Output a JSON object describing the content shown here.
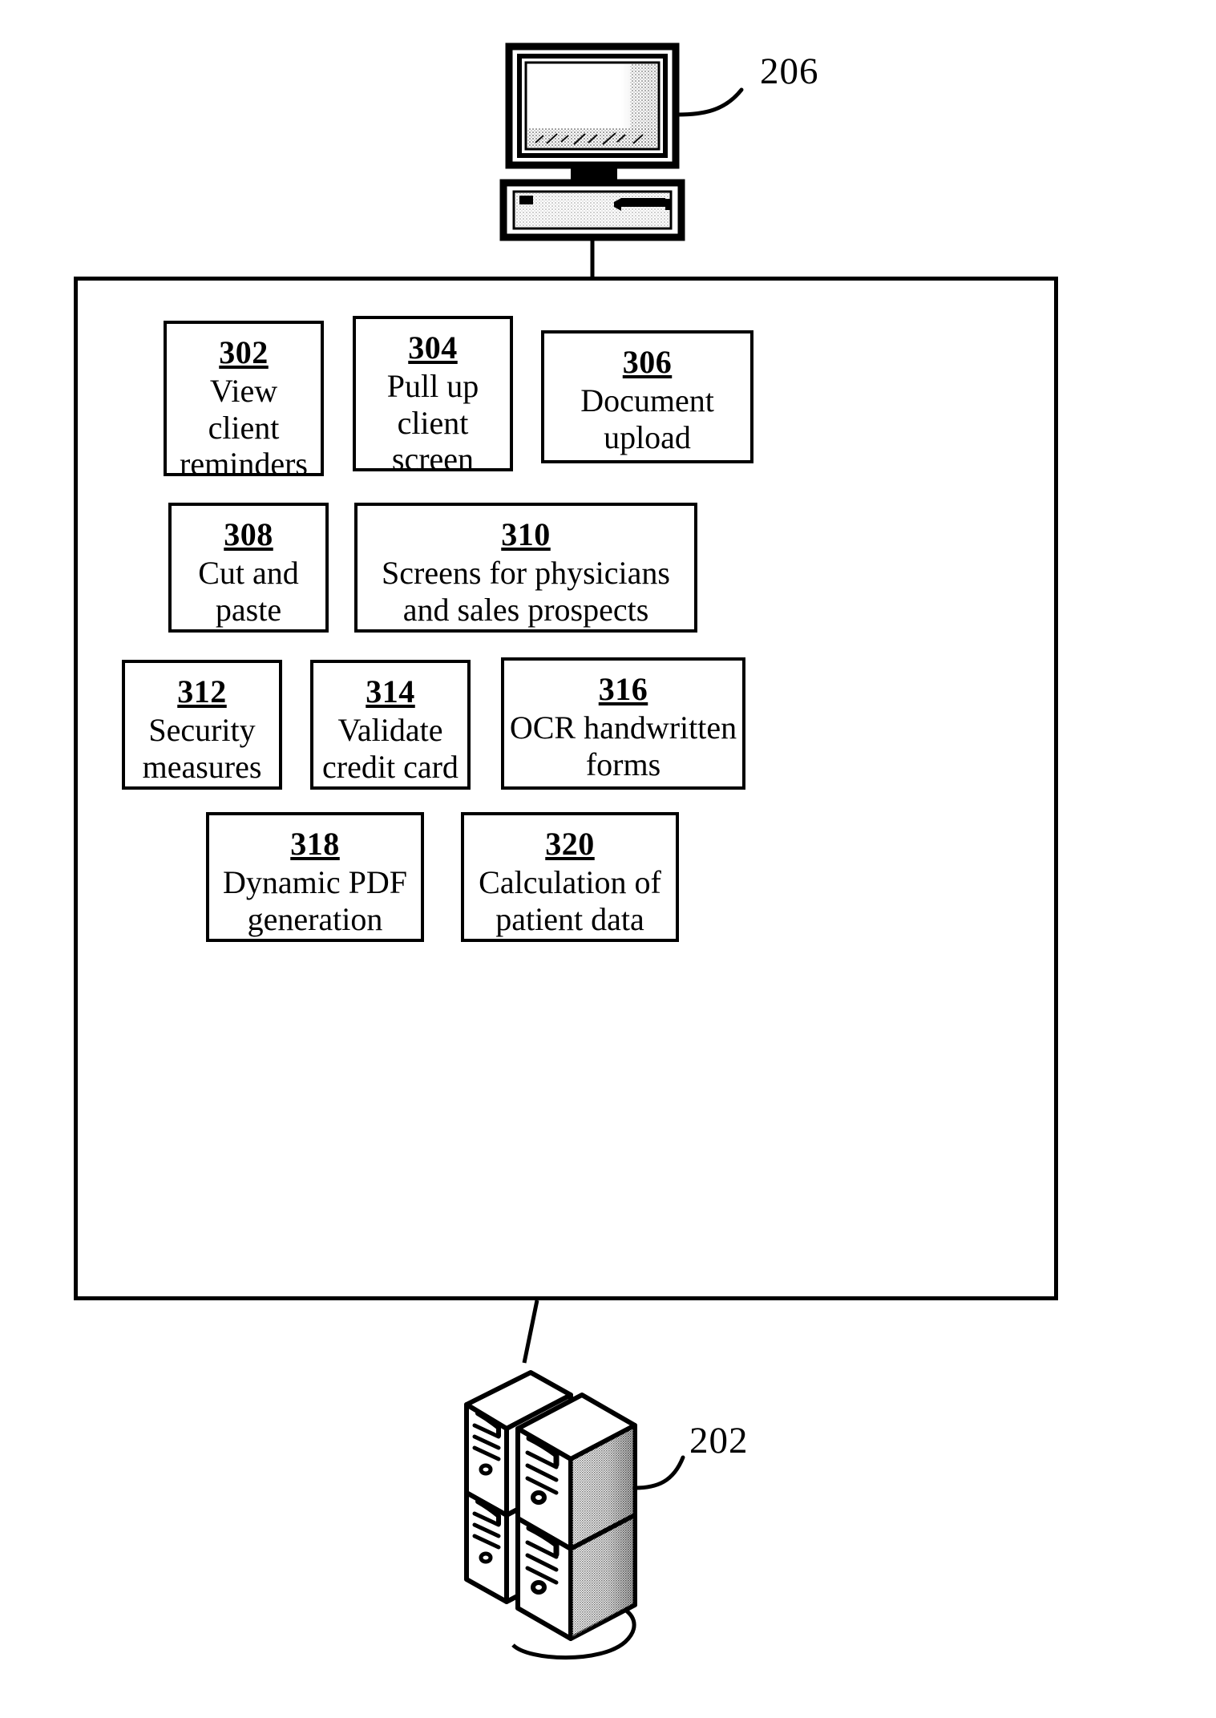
{
  "figure": {
    "title": "System functions block diagram",
    "ink_color": "#000000",
    "background_color": "#ffffff"
  },
  "nodes": {
    "client_computer": {
      "icon": "desktop-computer-icon",
      "ref": "206"
    },
    "server_stack": {
      "icon": "server-stack-icon",
      "ref": "202"
    }
  },
  "system_container": {
    "label": "",
    "rows": [
      {
        "boxes": [
          {
            "num": "302",
            "label": "View\nclient\nreminders"
          },
          {
            "num": "304",
            "label": "Pull up\nclient\nscreen"
          },
          {
            "num": "306",
            "label": "Document\nupload"
          }
        ]
      },
      {
        "boxes": [
          {
            "num": "308",
            "label": "Cut and\npaste"
          },
          {
            "num": "310",
            "label": "Screens for physicians\nand sales prospects"
          }
        ]
      },
      {
        "boxes": [
          {
            "num": "312",
            "label": "Security\nmeasures"
          },
          {
            "num": "314",
            "label": "Validate\ncredit card"
          },
          {
            "num": "316",
            "label": "OCR handwritten\nforms"
          }
        ]
      },
      {
        "boxes": [
          {
            "num": "318",
            "label": "Dynamic PDF\ngeneration"
          },
          {
            "num": "320",
            "label": "Calculation of\npatient data"
          }
        ]
      }
    ]
  }
}
